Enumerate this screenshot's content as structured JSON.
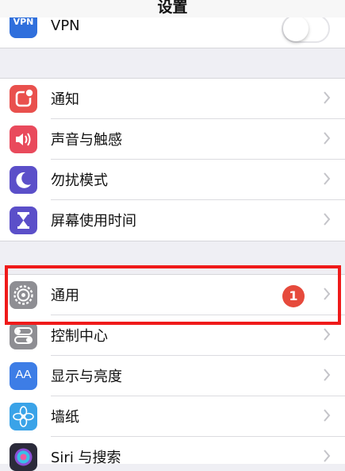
{
  "nav": {
    "title": "设置"
  },
  "vpn_row": {
    "label": "VPN",
    "icon_text": "VPN",
    "icon": "vpn-icon",
    "toggle_on": false
  },
  "group1": [
    {
      "label": "通知",
      "icon": "notifications-icon",
      "color": "#e9504d"
    },
    {
      "label": "声音与触感",
      "icon": "sounds-icon",
      "color": "#e94a5c"
    },
    {
      "label": "勿扰模式",
      "icon": "do-not-disturb-icon",
      "color": "#5b4fc9"
    },
    {
      "label": "屏幕使用时间",
      "icon": "screen-time-icon",
      "color": "#5b4fc9"
    }
  ],
  "group2": [
    {
      "label": "通用",
      "icon": "general-gear-icon",
      "color": "#8e8e93",
      "badge": "1"
    },
    {
      "label": "控制中心",
      "icon": "control-center-icon",
      "color": "#8e8e93"
    },
    {
      "label": "显示与亮度",
      "icon": "display-brightness-icon",
      "color": "#3d7de6",
      "icon_text": "AA"
    },
    {
      "label": "墙纸",
      "icon": "wallpaper-icon",
      "color": "#3aa3e8"
    },
    {
      "label": "Siri 与搜索",
      "icon": "siri-icon",
      "color": "#2b2b3a"
    }
  ],
  "colors": {
    "background": "#efeff4",
    "highlight_border": "#ef1a1a",
    "badge": "#e64a3c"
  }
}
